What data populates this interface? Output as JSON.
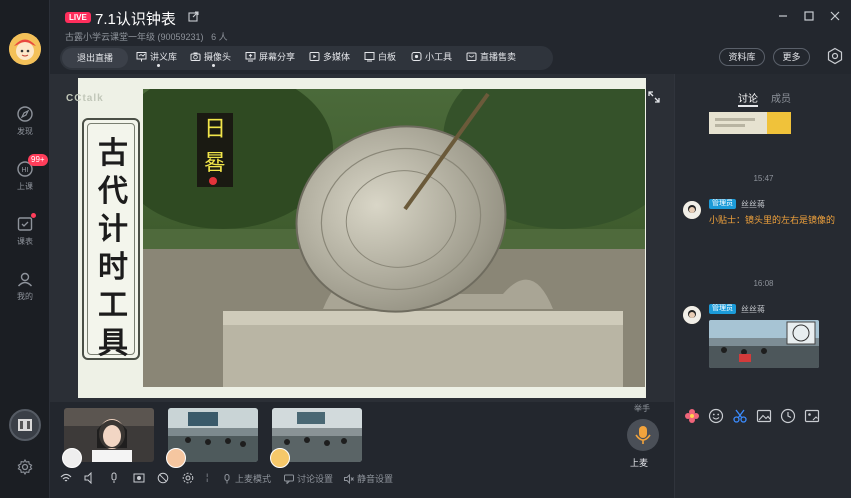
{
  "header": {
    "live_badge": "LIVE",
    "title": "7.1认识钟表",
    "subtitle": "古露小学云课堂一年级 (90059231)",
    "viewers": "6 人"
  },
  "rail": {
    "items": [
      {
        "label": "发现",
        "icon": "compass-icon"
      },
      {
        "label": "上课",
        "icon": "class-icon",
        "badge": "99+"
      },
      {
        "label": "课表",
        "icon": "calendar-icon"
      },
      {
        "label": "我的",
        "icon": "user-icon"
      }
    ]
  },
  "toolbar": {
    "end_live": "退出直播",
    "tools": [
      {
        "label": "讲义库",
        "icon": "slides-icon"
      },
      {
        "label": "摄像头",
        "icon": "camera-icon"
      },
      {
        "label": "屏幕分享",
        "icon": "screen-share-icon"
      },
      {
        "label": "多媒体",
        "icon": "media-icon"
      },
      {
        "label": "白板",
        "icon": "whiteboard-icon"
      },
      {
        "label": "小工具",
        "icon": "tools-icon"
      },
      {
        "label": "直播售卖",
        "icon": "shop-icon"
      }
    ],
    "resource": "资料库",
    "more": "更多"
  },
  "slide": {
    "logo": "CCtalk",
    "title_chars": [
      "古",
      "代",
      "计",
      "时",
      "工",
      "具"
    ],
    "caption_chars": [
      "日",
      "晷"
    ]
  },
  "strip": {
    "raise_hand": "举手",
    "mic_label": "上麦",
    "controls": [
      "上麦模式",
      "讨论设置",
      "静音设置"
    ]
  },
  "panel": {
    "tabs": [
      "讨论",
      "成员"
    ],
    "messages": [
      {
        "time": "15:47",
        "role": "管理员",
        "name": "丝丝蒋",
        "text": "小贴士：镜头里的左右是镜像的"
      },
      {
        "time": "16:08",
        "role": "管理员",
        "name": "丝丝蒋",
        "text": ""
      }
    ]
  },
  "colors": {
    "live": "#ff2e5c",
    "accent_orange": "#f2a33c",
    "role_blue": "#1c9bd8"
  }
}
